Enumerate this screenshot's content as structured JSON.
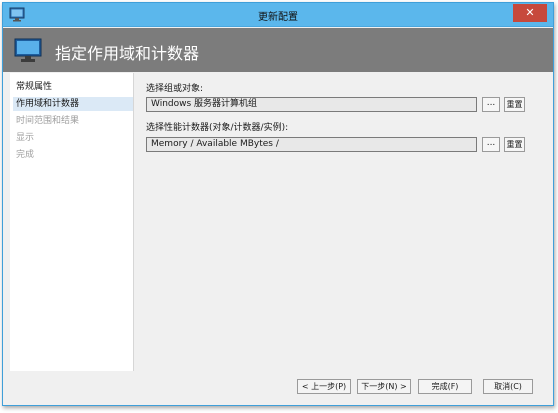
{
  "window": {
    "title": "更新配置",
    "close_symbol": "✕"
  },
  "header": {
    "title": "指定作用域和计数器"
  },
  "sidebar": {
    "items": [
      {
        "label": "常规属性",
        "state": "normal"
      },
      {
        "label": "作用域和计数器",
        "state": "selected"
      },
      {
        "label": "时间范围和结果",
        "state": "disabled"
      },
      {
        "label": "显示",
        "state": "disabled"
      },
      {
        "label": "完成",
        "state": "disabled"
      }
    ]
  },
  "main": {
    "group_label": "选择组或对象:",
    "group_value": "Windows 服务器计算机组",
    "counter_label": "选择性能计数器(对象/计数器/实例):",
    "counter_value": "Memory / Available MBytes /",
    "browse_label": "...",
    "reset_label": "重置"
  },
  "footer": {
    "prev_label": "< 上一步(P)",
    "next_label": "下一步(N) >",
    "finish_label": "完成(F)",
    "cancel_label": "取消(C)"
  },
  "colors": {
    "titlebar": "#5bb7ec",
    "close": "#c7493c",
    "header": "#7c7c7c",
    "selection": "#dbe9f6"
  }
}
